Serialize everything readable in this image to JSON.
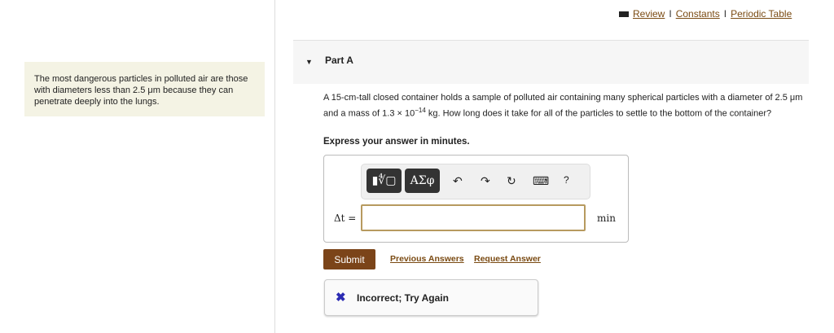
{
  "header": {
    "links": [
      "Review",
      "Constants",
      "Periodic Table"
    ],
    "separator": "I"
  },
  "intro": {
    "text": "The most dangerous particles in polluted air are those with diameters less than 2.5 μm because they can penetrate deeply into the lungs."
  },
  "part": {
    "label": "Part A"
  },
  "question": {
    "text": "A 15-cm-tall closed container holds a sample of polluted air containing many spherical particles with a diameter of 2.5 μm and a mass of 1.3 × 10",
    "exponent": "−14",
    "text_after": " kg. How long does it take for all of the particles to settle to the bottom of the container?",
    "instruction": "Express your answer in minutes."
  },
  "toolbar": {
    "template_label": "▮∜▢",
    "symbols_label": "ΑΣφ",
    "undo": "↶",
    "redo": "↷",
    "reset": "↻",
    "keyboard": "⌨",
    "help": "?"
  },
  "answer": {
    "label": "Δt =",
    "value": "",
    "unit": "min"
  },
  "actions": {
    "submit": "Submit",
    "previous": "Previous Answers",
    "request": "Request Answer"
  },
  "feedback": {
    "icon": "✖",
    "text": "Incorrect; Try Again"
  }
}
